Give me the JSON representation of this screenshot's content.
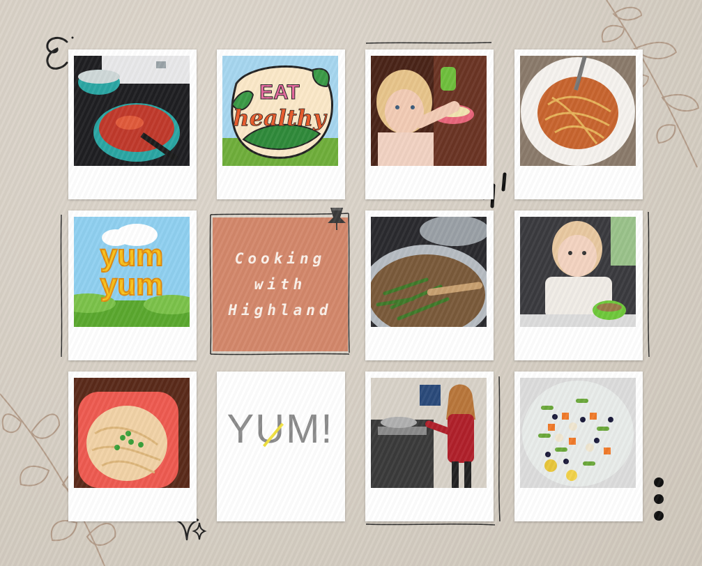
{
  "board": {
    "background_color": "#d6cfc4",
    "accent_color": "#d3876a"
  },
  "note": {
    "line1": "Cooking",
    "line2": "with",
    "line3": "Highland"
  },
  "stickers": {
    "eat": "EAT",
    "healthy": "healthy",
    "yum1": "yum",
    "yum2": "yum",
    "yum_big": "YUM!"
  },
  "photos": [
    {
      "icon": "pots-on-stove-photo"
    },
    {
      "icon": "eat-healthy-sticker"
    },
    {
      "icon": "toddler-eating-photo"
    },
    {
      "icon": "spaghetti-bowl-photo"
    },
    {
      "icon": "yum-yum-sticker"
    },
    {
      "icon": "cooking-with-highland-note"
    },
    {
      "icon": "green-beans-pan-photo"
    },
    {
      "icon": "baby-highchair-photo"
    },
    {
      "icon": "noodles-red-bowl-photo"
    },
    {
      "icon": "yum-text-card"
    },
    {
      "icon": "girl-at-stove-photo"
    },
    {
      "icon": "veggie-salad-photo"
    }
  ]
}
